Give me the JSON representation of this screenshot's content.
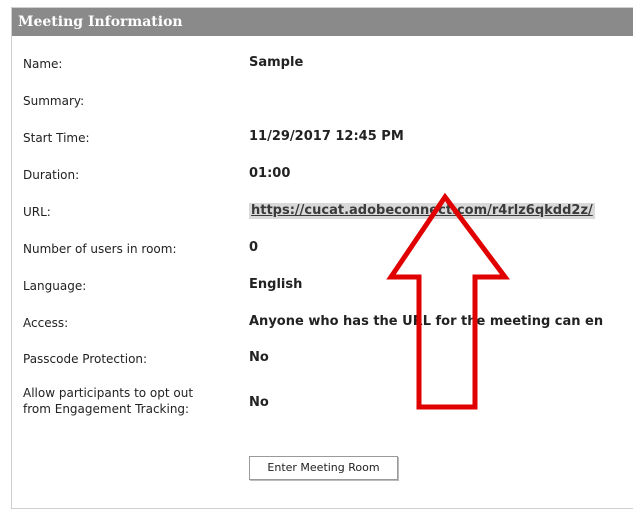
{
  "panel": {
    "title": "Meeting Information"
  },
  "fields": [
    {
      "label": "Name:",
      "value": "Sample"
    },
    {
      "label": "Summary:",
      "value": ""
    },
    {
      "label": "Start Time:",
      "value": "11/29/2017 12:45 PM"
    },
    {
      "label": "Duration:",
      "value": "01:00"
    },
    {
      "label": "URL:",
      "value": "https://cucat.adobeconnect.com/r4rlz6qkdd2z/"
    },
    {
      "label": "Number of users in room:",
      "value": "0"
    },
    {
      "label": "Language:",
      "value": "English"
    },
    {
      "label": "Access:",
      "value": "Anyone who has the URL for the meeting can en"
    },
    {
      "label": "Passcode Protection:",
      "value": "No"
    },
    {
      "label_line1": "Allow participants to opt out",
      "label_line2": "from Engagement Tracking:",
      "value": "No"
    }
  ],
  "button": {
    "label": "Enter Meeting Room"
  },
  "colors": {
    "header_bg": "#8a8a8a",
    "annotation_arrow": "#e00000"
  }
}
